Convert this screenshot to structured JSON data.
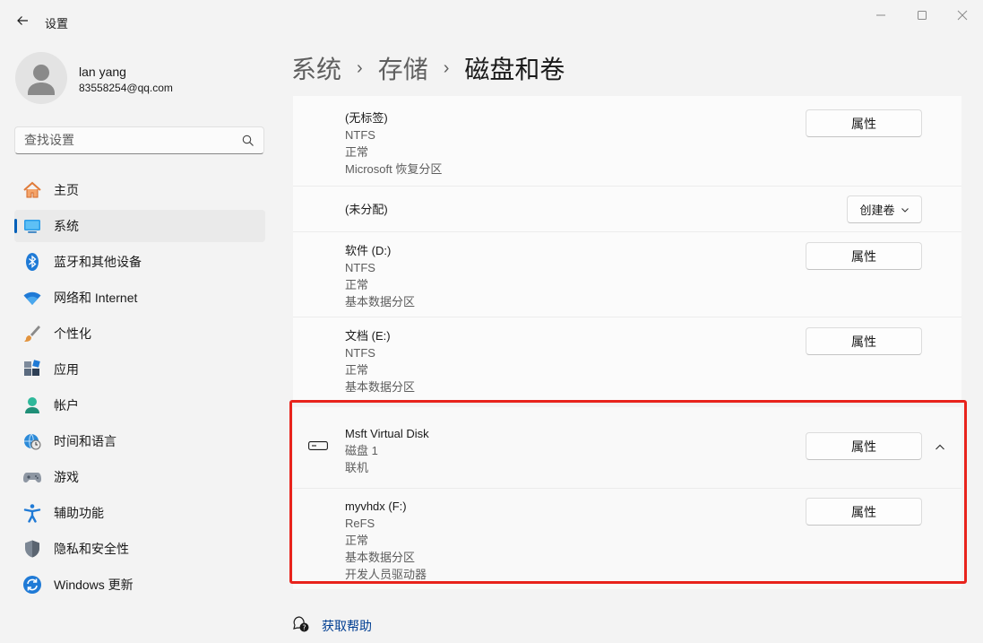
{
  "app": {
    "title": "设置"
  },
  "user": {
    "name": "lan yang",
    "email": "83558254@qq.com"
  },
  "search": {
    "placeholder": "查找设置"
  },
  "nav": {
    "items": [
      {
        "label": "主页"
      },
      {
        "label": "系统"
      },
      {
        "label": "蓝牙和其他设备"
      },
      {
        "label": "网络和 Internet"
      },
      {
        "label": "个性化"
      },
      {
        "label": "应用"
      },
      {
        "label": "帐户"
      },
      {
        "label": "时间和语言"
      },
      {
        "label": "游戏"
      },
      {
        "label": "辅助功能"
      },
      {
        "label": "隐私和安全性"
      },
      {
        "label": "Windows 更新"
      }
    ],
    "active_index": 1
  },
  "breadcrumb": {
    "item1": "系统",
    "item2": "存储",
    "current": "磁盘和卷",
    "separator": "›"
  },
  "volumes": [
    {
      "name": "(无标签)",
      "fs": "NTFS",
      "status": "正常",
      "type": "Microsoft 恢复分区",
      "button": "属性"
    },
    {
      "name": "(未分配)",
      "button": "创建卷"
    },
    {
      "name": "软件 (D:)",
      "fs": "NTFS",
      "status": "正常",
      "type": "基本数据分区",
      "button": "属性"
    },
    {
      "name": "文档 (E:)",
      "fs": "NTFS",
      "status": "正常",
      "type": "基本数据分区",
      "button": "属性"
    }
  ],
  "disk": {
    "name": "Msft Virtual Disk",
    "number": "磁盘 1",
    "state": "联机",
    "button": "属性",
    "volume": {
      "name": "myvhdx (F:)",
      "fs": "ReFS",
      "status": "正常",
      "type": "基本数据分区",
      "extra": "开发人员驱动器",
      "button": "属性"
    }
  },
  "help": {
    "label": "获取帮助"
  },
  "colors": {
    "accent": "#005fb8",
    "highlight": "#e8231c",
    "link": "#003e92"
  }
}
